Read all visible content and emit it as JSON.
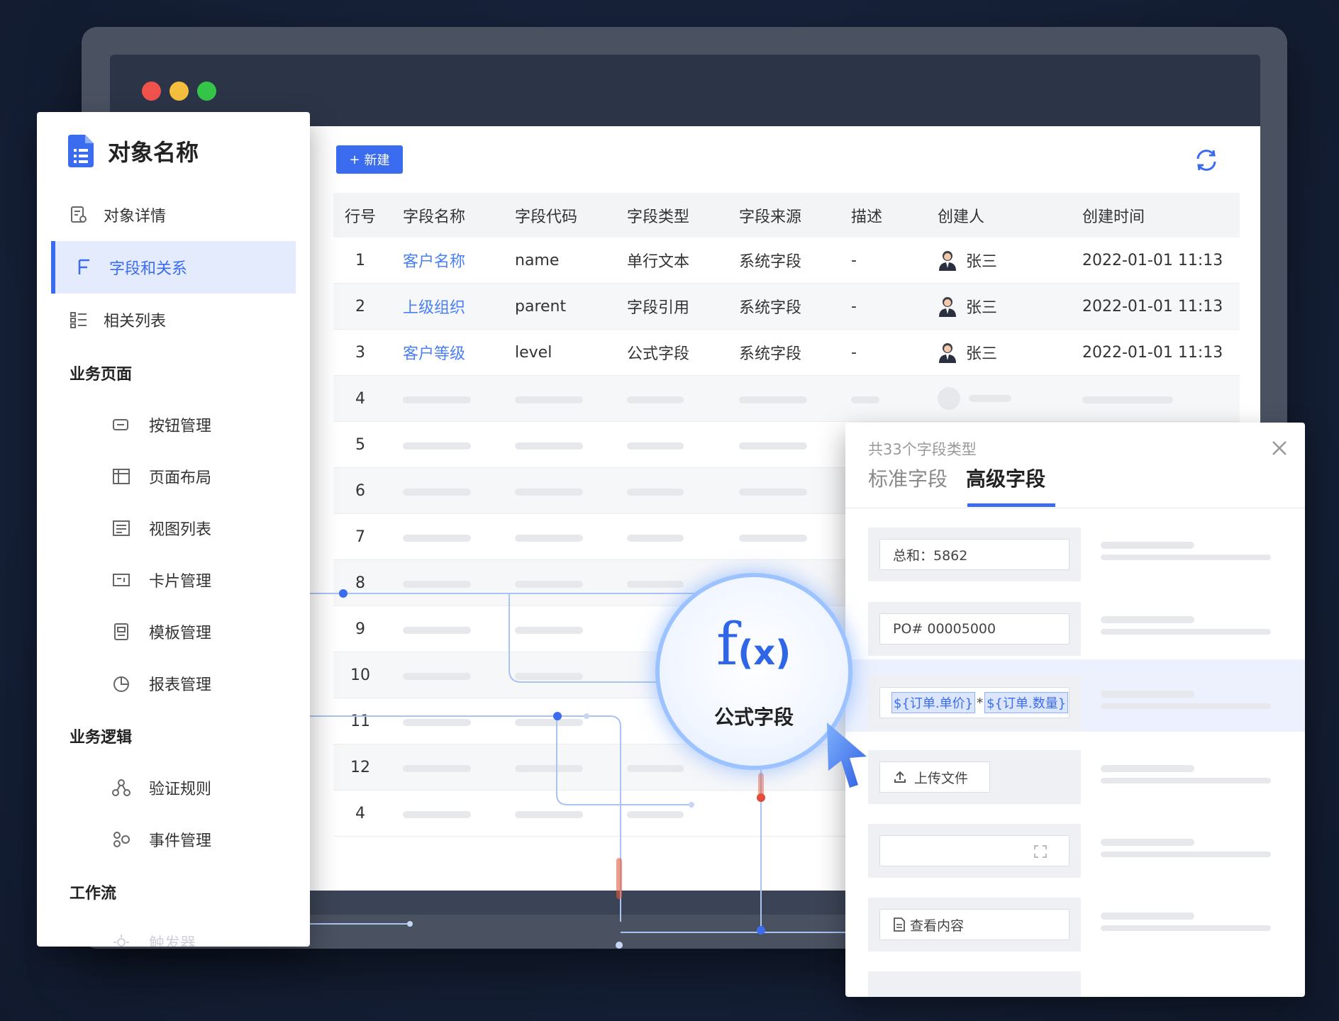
{
  "window": {
    "controls": [
      "close",
      "minimize",
      "maximize"
    ]
  },
  "sidebar": {
    "title": "对象名称",
    "items": [
      {
        "label": "对象详情",
        "icon": "object-detail-icon"
      },
      {
        "label": "字段和关系",
        "icon": "field-icon",
        "active": true
      },
      {
        "label": "相关列表",
        "icon": "list-icon"
      }
    ],
    "groups": [
      {
        "title": "业务页面",
        "items": [
          {
            "label": "按钮管理",
            "icon": "button-icon"
          },
          {
            "label": "页面布局",
            "icon": "layout-icon"
          },
          {
            "label": "视图列表",
            "icon": "view-icon"
          },
          {
            "label": "卡片管理",
            "icon": "card-icon"
          },
          {
            "label": "模板管理",
            "icon": "template-icon"
          },
          {
            "label": "报表管理",
            "icon": "report-icon"
          }
        ]
      },
      {
        "title": "业务逻辑",
        "items": [
          {
            "label": "验证规则",
            "icon": "validation-icon"
          },
          {
            "label": "事件管理",
            "icon": "event-icon"
          }
        ]
      },
      {
        "title": "工作流",
        "items": [
          {
            "label": "触发器",
            "icon": "trigger-icon"
          }
        ]
      }
    ]
  },
  "toolbar": {
    "new_label": "新建"
  },
  "table": {
    "headers": [
      "行号",
      "字段名称",
      "字段代码",
      "字段类型",
      "字段来源",
      "描述",
      "创建人",
      "创建时间"
    ],
    "rows": [
      {
        "no": "1",
        "name": "客户名称",
        "code": "name",
        "type": "单行文本",
        "source": "系统字段",
        "desc": "-",
        "creator": "张三",
        "time": "2022-01-01 11:13"
      },
      {
        "no": "2",
        "name": "上级组织",
        "code": "parent",
        "type": "字段引用",
        "source": "系统字段",
        "desc": "-",
        "creator": "张三",
        "time": "2022-01-01 11:13"
      },
      {
        "no": "3",
        "name": "客户等级",
        "code": "level",
        "type": "公式字段",
        "source": "系统字段",
        "desc": "-",
        "creator": "张三",
        "time": "2022-01-01 11:13"
      }
    ],
    "placeholder_row_numbers": [
      "4",
      "5",
      "6",
      "7",
      "8",
      "9",
      "10",
      "11",
      "12",
      "4"
    ]
  },
  "panel": {
    "subtitle": "共33个字段类型",
    "tabs": [
      "标准字段",
      "高级字段"
    ],
    "fields": {
      "sum": "总和：5862",
      "po": "PO# 00005000",
      "formula_a": "${订单.单价}",
      "formula_op": "*",
      "formula_b": "${订单.数量}",
      "upload": "上传文件",
      "view": "查看内容"
    }
  },
  "bubble": {
    "symbol": "f",
    "args": "(x)",
    "label": "公式字段"
  },
  "colors": {
    "accent": "#3b6cf0",
    "link": "#4a7ff5",
    "active_bg": "#e3ebfd"
  }
}
